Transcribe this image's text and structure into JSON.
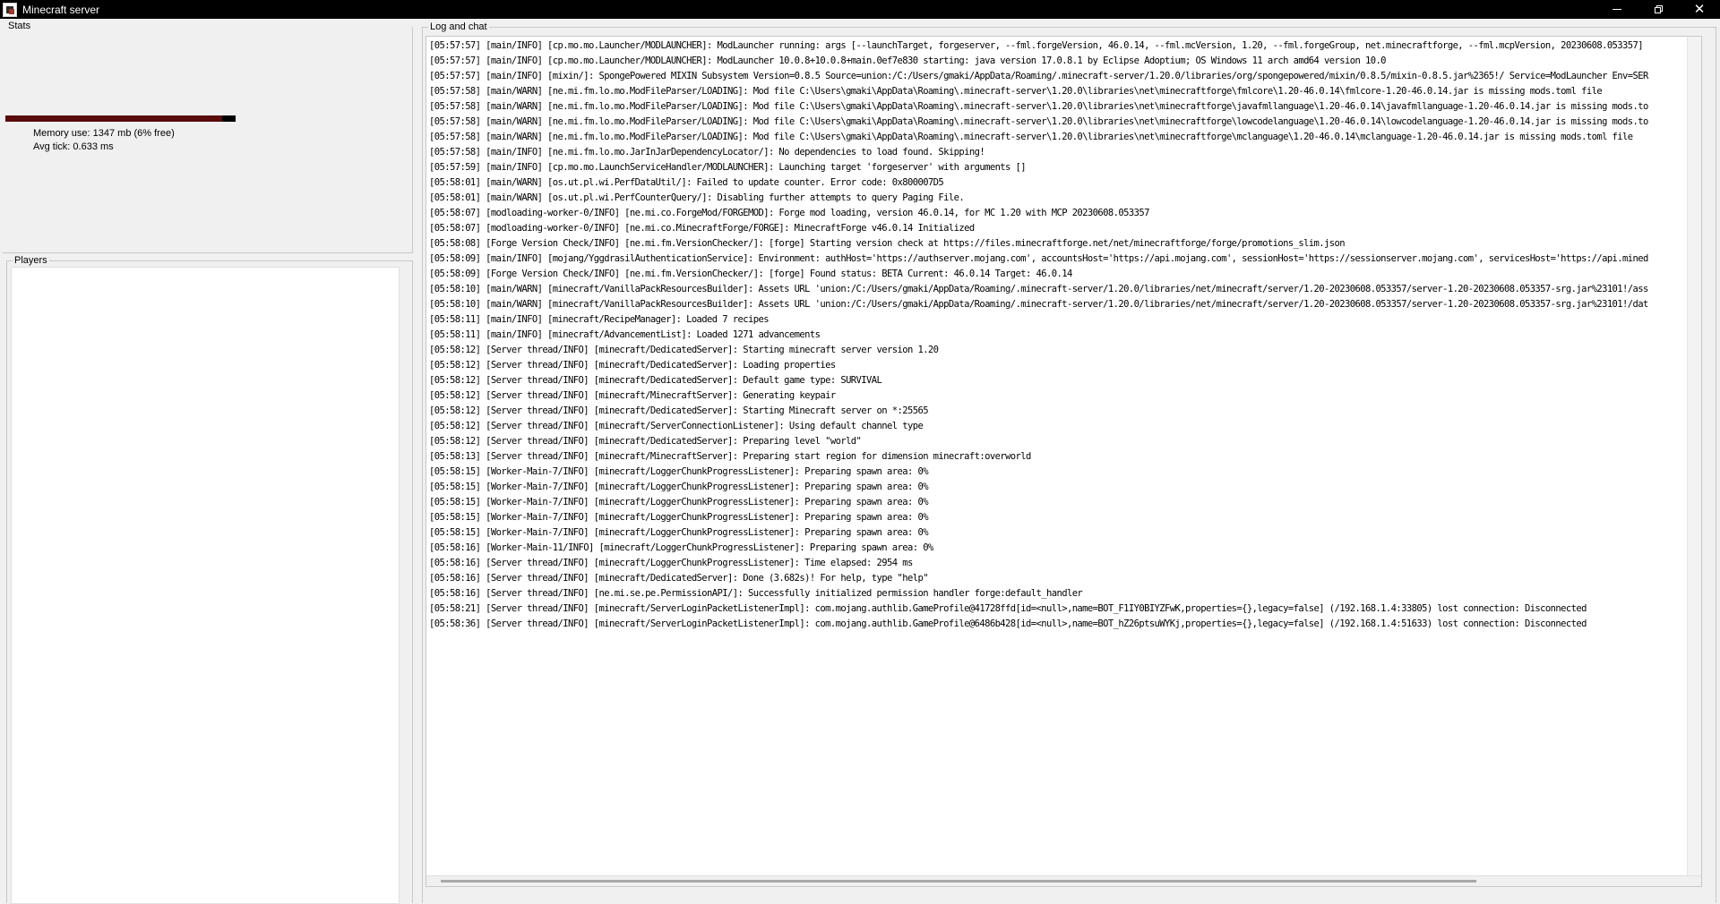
{
  "window": {
    "title": "Minecraft server",
    "icons": {
      "app": "minecraft-server-icon",
      "minimize": "minimize-icon",
      "restore": "restore-icon",
      "close": "close-icon"
    },
    "close_glyph": "✕"
  },
  "stats": {
    "label": "Stats",
    "memory_text": "Memory use: 1347 mb (6% free)",
    "memory_used_fraction": 0.94,
    "tick_text": "Avg tick: 0.633 ms",
    "colors": {
      "bar_background": "#000000",
      "bar_fill": "#5a0b0b"
    }
  },
  "players": {
    "label": "Players",
    "items": []
  },
  "log": {
    "label": "Log and chat",
    "lines": [
      "[05:57:57] [main/INFO] [cp.mo.mo.Launcher/MODLAUNCHER]: ModLauncher running: args [--launchTarget, forgeserver, --fml.forgeVersion, 46.0.14, --fml.mcVersion, 1.20, --fml.forgeGroup, net.minecraftforge, --fml.mcpVersion, 20230608.053357]",
      "[05:57:57] [main/INFO] [cp.mo.mo.Launcher/MODLAUNCHER]: ModLauncher 10.0.8+10.0.8+main.0ef7e830 starting: java version 17.0.8.1 by Eclipse Adoptium; OS Windows 11 arch amd64 version 10.0",
      "[05:57:57] [main/INFO] [mixin/]: SpongePowered MIXIN Subsystem Version=0.8.5 Source=union:/C:/Users/gmaki/AppData/Roaming/.minecraft-server/1.20.0/libraries/org/spongepowered/mixin/0.8.5/mixin-0.8.5.jar%2365!/ Service=ModLauncher Env=SER",
      "[05:57:58] [main/WARN] [ne.mi.fm.lo.mo.ModFileParser/LOADING]: Mod file C:\\Users\\gmaki\\AppData\\Roaming\\.minecraft-server\\1.20.0\\libraries\\net\\minecraftforge\\fmlcore\\1.20-46.0.14\\fmlcore-1.20-46.0.14.jar is missing mods.toml file",
      "[05:57:58] [main/WARN] [ne.mi.fm.lo.mo.ModFileParser/LOADING]: Mod file C:\\Users\\gmaki\\AppData\\Roaming\\.minecraft-server\\1.20.0\\libraries\\net\\minecraftforge\\javafmllanguage\\1.20-46.0.14\\javafmllanguage-1.20-46.0.14.jar is missing mods.to",
      "[05:57:58] [main/WARN] [ne.mi.fm.lo.mo.ModFileParser/LOADING]: Mod file C:\\Users\\gmaki\\AppData\\Roaming\\.minecraft-server\\1.20.0\\libraries\\net\\minecraftforge\\lowcodelanguage\\1.20-46.0.14\\lowcodelanguage-1.20-46.0.14.jar is missing mods.to",
      "[05:57:58] [main/WARN] [ne.mi.fm.lo.mo.ModFileParser/LOADING]: Mod file C:\\Users\\gmaki\\AppData\\Roaming\\.minecraft-server\\1.20.0\\libraries\\net\\minecraftforge\\mclanguage\\1.20-46.0.14\\mclanguage-1.20-46.0.14.jar is missing mods.toml file",
      "[05:57:58] [main/INFO] [ne.mi.fm.lo.mo.JarInJarDependencyLocator/]: No dependencies to load found. Skipping!",
      "[05:57:59] [main/INFO] [cp.mo.mo.LaunchServiceHandler/MODLAUNCHER]: Launching target 'forgeserver' with arguments []",
      "[05:58:01] [main/WARN] [os.ut.pl.wi.PerfDataUtil/]: Failed to update counter. Error code: 0x800007D5",
      "[05:58:01] [main/WARN] [os.ut.pl.wi.PerfCounterQuery/]: Disabling further attempts to query Paging File.",
      "[05:58:07] [modloading-worker-0/INFO] [ne.mi.co.ForgeMod/FORGEMOD]: Forge mod loading, version 46.0.14, for MC 1.20 with MCP 20230608.053357",
      "[05:58:07] [modloading-worker-0/INFO] [ne.mi.co.MinecraftForge/FORGE]: MinecraftForge v46.0.14 Initialized",
      "[05:58:08] [Forge Version Check/INFO] [ne.mi.fm.VersionChecker/]: [forge] Starting version check at https://files.minecraftforge.net/net/minecraftforge/forge/promotions_slim.json",
      "[05:58:09] [main/INFO] [mojang/YggdrasilAuthenticationService]: Environment: authHost='https://authserver.mojang.com', accountsHost='https://api.mojang.com', sessionHost='https://sessionserver.mojang.com', servicesHost='https://api.mined",
      "[05:58:09] [Forge Version Check/INFO] [ne.mi.fm.VersionChecker/]: [forge] Found status: BETA Current: 46.0.14 Target: 46.0.14",
      "[05:58:10] [main/WARN] [minecraft/VanillaPackResourcesBuilder]: Assets URL 'union:/C:/Users/gmaki/AppData/Roaming/.minecraft-server/1.20.0/libraries/net/minecraft/server/1.20-20230608.053357/server-1.20-20230608.053357-srg.jar%23101!/ass",
      "[05:58:10] [main/WARN] [minecraft/VanillaPackResourcesBuilder]: Assets URL 'union:/C:/Users/gmaki/AppData/Roaming/.minecraft-server/1.20.0/libraries/net/minecraft/server/1.20-20230608.053357/server-1.20-20230608.053357-srg.jar%23101!/dat",
      "[05:58:11] [main/INFO] [minecraft/RecipeManager]: Loaded 7 recipes",
      "[05:58:11] [main/INFO] [minecraft/AdvancementList]: Loaded 1271 advancements",
      "[05:58:12] [Server thread/INFO] [minecraft/DedicatedServer]: Starting minecraft server version 1.20",
      "[05:58:12] [Server thread/INFO] [minecraft/DedicatedServer]: Loading properties",
      "[05:58:12] [Server thread/INFO] [minecraft/DedicatedServer]: Default game type: SURVIVAL",
      "[05:58:12] [Server thread/INFO] [minecraft/MinecraftServer]: Generating keypair",
      "[05:58:12] [Server thread/INFO] [minecraft/DedicatedServer]: Starting Minecraft server on *:25565",
      "[05:58:12] [Server thread/INFO] [minecraft/ServerConnectionListener]: Using default channel type",
      "[05:58:12] [Server thread/INFO] [minecraft/DedicatedServer]: Preparing level \"world\"",
      "[05:58:13] [Server thread/INFO] [minecraft/MinecraftServer]: Preparing start region for dimension minecraft:overworld",
      "[05:58:15] [Worker-Main-7/INFO] [minecraft/LoggerChunkProgressListener]: Preparing spawn area: 0%",
      "[05:58:15] [Worker-Main-7/INFO] [minecraft/LoggerChunkProgressListener]: Preparing spawn area: 0%",
      "[05:58:15] [Worker-Main-7/INFO] [minecraft/LoggerChunkProgressListener]: Preparing spawn area: 0%",
      "[05:58:15] [Worker-Main-7/INFO] [minecraft/LoggerChunkProgressListener]: Preparing spawn area: 0%",
      "[05:58:15] [Worker-Main-7/INFO] [minecraft/LoggerChunkProgressListener]: Preparing spawn area: 0%",
      "[05:58:16] [Worker-Main-11/INFO] [minecraft/LoggerChunkProgressListener]: Preparing spawn area: 0%",
      "[05:58:16] [Server thread/INFO] [minecraft/LoggerChunkProgressListener]: Time elapsed: 2954 ms",
      "[05:58:16] [Server thread/INFO] [minecraft/DedicatedServer]: Done (3.682s)! For help, type \"help\"",
      "[05:58:16] [Server thread/INFO] [ne.mi.se.pe.PermissionAPI/]: Successfully initialized permission handler forge:default_handler",
      "[05:58:21] [Server thread/INFO] [minecraft/ServerLoginPacketListenerImpl]: com.mojang.authlib.GameProfile@41728ffd[id=<null>,name=BOT_F1IY0BIYZFwK,properties={},legacy=false] (/192.168.1.4:33805) lost connection: Disconnected",
      "[05:58:36] [Server thread/INFO] [minecraft/ServerLoginPacketListenerImpl]: com.mojang.authlib.GameProfile@6486b428[id=<null>,name=BOT_hZ26ptsuWYKj,properties={},legacy=false] (/192.168.1.4:51633) lost connection: Disconnected"
    ]
  },
  "colors": {
    "window_bg": "#f0f0f0",
    "titlebar_bg": "#000000",
    "titlebar_text": "#ffffff",
    "text_area_bg": "#ffffff"
  }
}
